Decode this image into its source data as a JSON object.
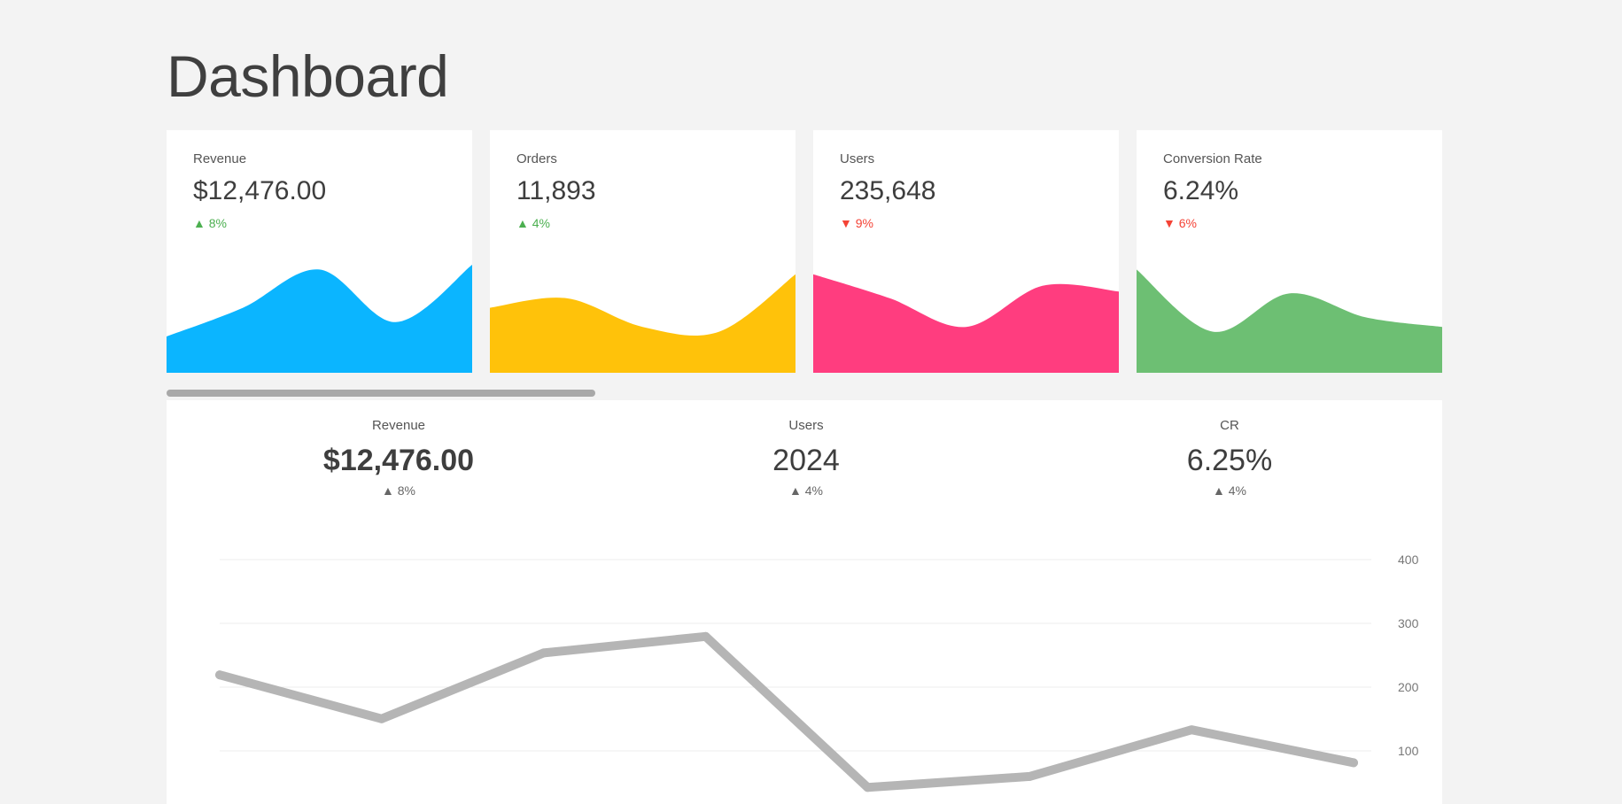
{
  "page": {
    "title": "Dashboard"
  },
  "colors": {
    "revenue": "#0bb5ff",
    "orders": "#ffc20a",
    "users": "#ff3d7f",
    "conversion": "#6dbf73",
    "up": "#4caf50",
    "down": "#f44336",
    "line": "#b5b5b5"
  },
  "cards": [
    {
      "label": "Revenue",
      "value": "$12,476.00",
      "delta": "▲ 8%",
      "trend": "up",
      "color_key": "revenue",
      "spark": [
        0.25,
        0.55,
        0.95,
        0.4,
        1.0
      ]
    },
    {
      "label": "Orders",
      "value": "11,893",
      "delta": "▲ 4%",
      "trend": "up",
      "color_key": "orders",
      "spark": [
        0.55,
        0.65,
        0.35,
        0.3,
        0.9
      ]
    },
    {
      "label": "Users",
      "value": "235,648",
      "delta": "▼ 9%",
      "trend": "down",
      "color_key": "users",
      "spark": [
        0.9,
        0.65,
        0.35,
        0.78,
        0.72
      ]
    },
    {
      "label": "Conversion Rate",
      "value": "6.24%",
      "delta": "▼ 6%",
      "trend": "down",
      "color_key": "conversion",
      "spark": [
        0.95,
        0.3,
        0.7,
        0.45,
        0.35
      ]
    }
  ],
  "summary": [
    {
      "label": "Revenue",
      "value": "$12,476.00",
      "delta": "▲ 8%"
    },
    {
      "label": "Users",
      "value": "2024",
      "delta": "▲ 4%"
    },
    {
      "label": "CR",
      "value": "6.25%",
      "delta": "▲ 4%"
    }
  ],
  "chart_data": {
    "type": "line",
    "values": [
      58,
      42,
      66,
      72,
      17,
      21,
      38,
      26
    ],
    "yticks": [
      "400",
      "300",
      "200",
      "100"
    ],
    "ylim": [
      0,
      100
    ]
  }
}
